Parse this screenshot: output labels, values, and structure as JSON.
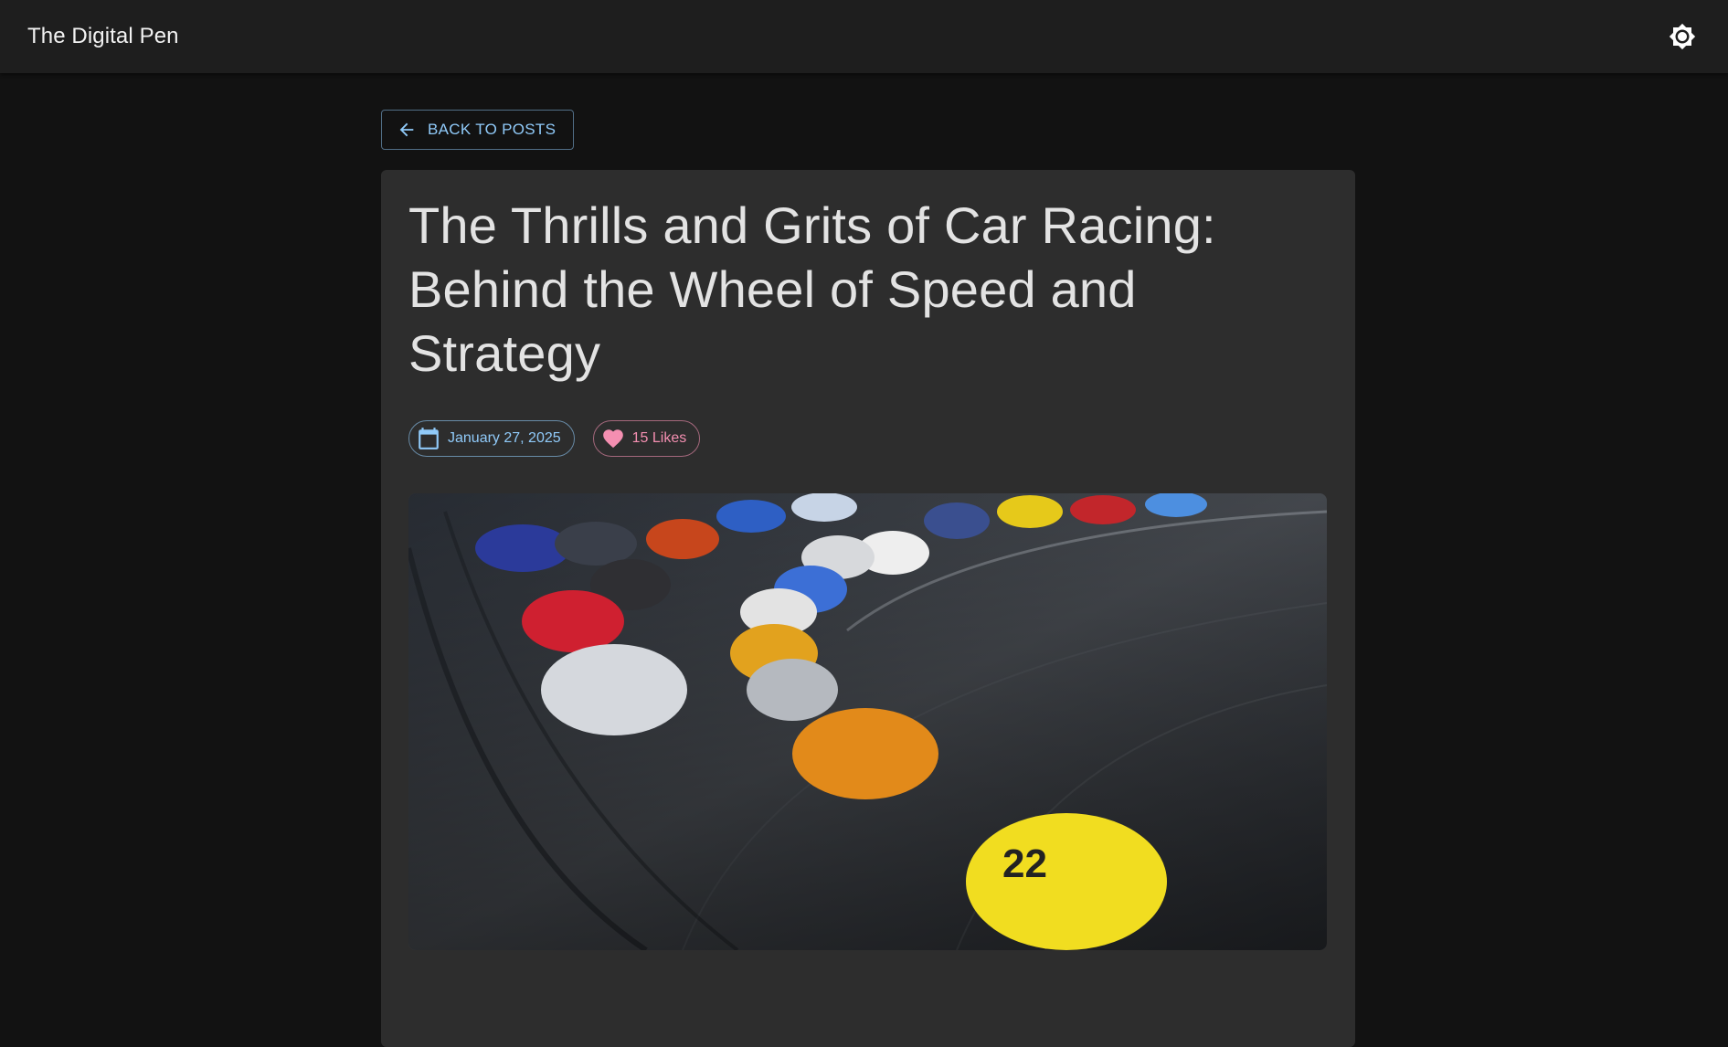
{
  "header": {
    "brand": "The Digital Pen",
    "theme_icon": "brightness-icon"
  },
  "nav": {
    "back_label": "BACK TO POSTS",
    "back_icon": "arrow-left-icon"
  },
  "post": {
    "title": "The Thrills and Grits of Car Racing: Behind the Wheel of Speed and Strategy",
    "date": "January 27, 2025",
    "likes": "15 Likes",
    "date_icon": "calendar-icon",
    "likes_icon": "heart-icon"
  },
  "colors": {
    "background": "#121212",
    "appbar": "#1e1e1e",
    "card": "#2d2d2d",
    "primary": "#90caf9",
    "secondary": "#f48fb1"
  }
}
